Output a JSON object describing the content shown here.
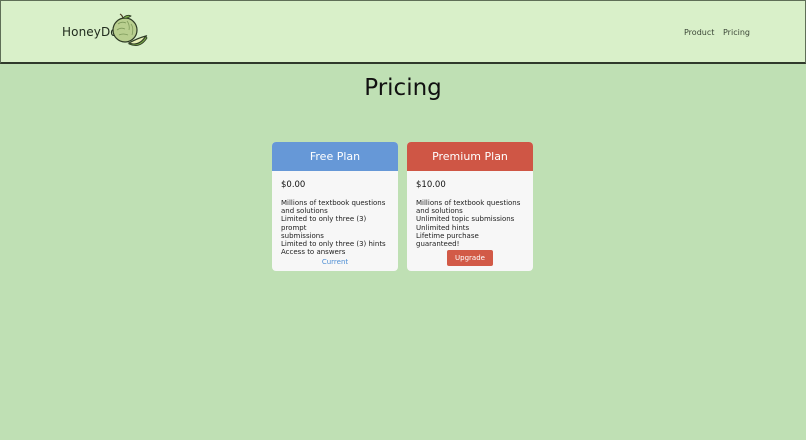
{
  "navbar": {
    "brand": "HoneyDo",
    "links": [
      {
        "label": "Product"
      },
      {
        "label": "Pricing"
      }
    ]
  },
  "page": {
    "title": "Pricing"
  },
  "plans": [
    {
      "name": "Free Plan",
      "price": "$0.00",
      "features": [
        "Millions of textbook questions",
        "and solutions",
        "Limited to only three (3) prompt",
        "submissions",
        "Limited to only three (3) hints",
        "Access to answers"
      ],
      "action_label": "Current",
      "header_color": "#6698d7"
    },
    {
      "name": "Premium Plan",
      "price": "$10.00",
      "features": [
        "Millions of textbook questions",
        "and solutions",
        "Unlimited topic submissions",
        "Unlimited hints",
        "Lifetime purchase guaranteed!"
      ],
      "action_label": "Upgrade",
      "header_color": "#cf5645"
    }
  ],
  "colors": {
    "background": "#bfe0b4",
    "navbar": "#d9f0c9"
  },
  "icons": {
    "logo": "melon-icon"
  }
}
